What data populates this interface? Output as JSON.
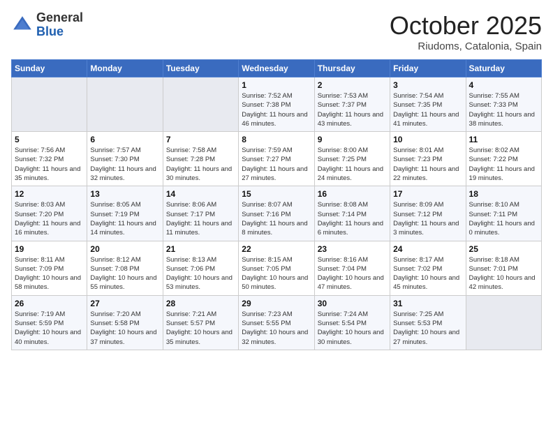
{
  "header": {
    "logo_general": "General",
    "logo_blue": "Blue",
    "month_title": "October 2025",
    "location": "Riudoms, Catalonia, Spain"
  },
  "weekdays": [
    "Sunday",
    "Monday",
    "Tuesday",
    "Wednesday",
    "Thursday",
    "Friday",
    "Saturday"
  ],
  "weeks": [
    [
      {
        "day": "",
        "empty": true
      },
      {
        "day": "",
        "empty": true
      },
      {
        "day": "",
        "empty": true
      },
      {
        "day": "1",
        "sunrise": "7:52 AM",
        "sunset": "7:38 PM",
        "daylight": "11 hours and 46 minutes."
      },
      {
        "day": "2",
        "sunrise": "7:53 AM",
        "sunset": "7:37 PM",
        "daylight": "11 hours and 43 minutes."
      },
      {
        "day": "3",
        "sunrise": "7:54 AM",
        "sunset": "7:35 PM",
        "daylight": "11 hours and 41 minutes."
      },
      {
        "day": "4",
        "sunrise": "7:55 AM",
        "sunset": "7:33 PM",
        "daylight": "11 hours and 38 minutes."
      }
    ],
    [
      {
        "day": "5",
        "sunrise": "7:56 AM",
        "sunset": "7:32 PM",
        "daylight": "11 hours and 35 minutes."
      },
      {
        "day": "6",
        "sunrise": "7:57 AM",
        "sunset": "7:30 PM",
        "daylight": "11 hours and 32 minutes."
      },
      {
        "day": "7",
        "sunrise": "7:58 AM",
        "sunset": "7:28 PM",
        "daylight": "11 hours and 30 minutes."
      },
      {
        "day": "8",
        "sunrise": "7:59 AM",
        "sunset": "7:27 PM",
        "daylight": "11 hours and 27 minutes."
      },
      {
        "day": "9",
        "sunrise": "8:00 AM",
        "sunset": "7:25 PM",
        "daylight": "11 hours and 24 minutes."
      },
      {
        "day": "10",
        "sunrise": "8:01 AM",
        "sunset": "7:23 PM",
        "daylight": "11 hours and 22 minutes."
      },
      {
        "day": "11",
        "sunrise": "8:02 AM",
        "sunset": "7:22 PM",
        "daylight": "11 hours and 19 minutes."
      }
    ],
    [
      {
        "day": "12",
        "sunrise": "8:03 AM",
        "sunset": "7:20 PM",
        "daylight": "11 hours and 16 minutes."
      },
      {
        "day": "13",
        "sunrise": "8:05 AM",
        "sunset": "7:19 PM",
        "daylight": "11 hours and 14 minutes."
      },
      {
        "day": "14",
        "sunrise": "8:06 AM",
        "sunset": "7:17 PM",
        "daylight": "11 hours and 11 minutes."
      },
      {
        "day": "15",
        "sunrise": "8:07 AM",
        "sunset": "7:16 PM",
        "daylight": "11 hours and 8 minutes."
      },
      {
        "day": "16",
        "sunrise": "8:08 AM",
        "sunset": "7:14 PM",
        "daylight": "11 hours and 6 minutes."
      },
      {
        "day": "17",
        "sunrise": "8:09 AM",
        "sunset": "7:12 PM",
        "daylight": "11 hours and 3 minutes."
      },
      {
        "day": "18",
        "sunrise": "8:10 AM",
        "sunset": "7:11 PM",
        "daylight": "11 hours and 0 minutes."
      }
    ],
    [
      {
        "day": "19",
        "sunrise": "8:11 AM",
        "sunset": "7:09 PM",
        "daylight": "10 hours and 58 minutes."
      },
      {
        "day": "20",
        "sunrise": "8:12 AM",
        "sunset": "7:08 PM",
        "daylight": "10 hours and 55 minutes."
      },
      {
        "day": "21",
        "sunrise": "8:13 AM",
        "sunset": "7:06 PM",
        "daylight": "10 hours and 53 minutes."
      },
      {
        "day": "22",
        "sunrise": "8:15 AM",
        "sunset": "7:05 PM",
        "daylight": "10 hours and 50 minutes."
      },
      {
        "day": "23",
        "sunrise": "8:16 AM",
        "sunset": "7:04 PM",
        "daylight": "10 hours and 47 minutes."
      },
      {
        "day": "24",
        "sunrise": "8:17 AM",
        "sunset": "7:02 PM",
        "daylight": "10 hours and 45 minutes."
      },
      {
        "day": "25",
        "sunrise": "8:18 AM",
        "sunset": "7:01 PM",
        "daylight": "10 hours and 42 minutes."
      }
    ],
    [
      {
        "day": "26",
        "sunrise": "7:19 AM",
        "sunset": "5:59 PM",
        "daylight": "10 hours and 40 minutes."
      },
      {
        "day": "27",
        "sunrise": "7:20 AM",
        "sunset": "5:58 PM",
        "daylight": "10 hours and 37 minutes."
      },
      {
        "day": "28",
        "sunrise": "7:21 AM",
        "sunset": "5:57 PM",
        "daylight": "10 hours and 35 minutes."
      },
      {
        "day": "29",
        "sunrise": "7:23 AM",
        "sunset": "5:55 PM",
        "daylight": "10 hours and 32 minutes."
      },
      {
        "day": "30",
        "sunrise": "7:24 AM",
        "sunset": "5:54 PM",
        "daylight": "10 hours and 30 minutes."
      },
      {
        "day": "31",
        "sunrise": "7:25 AM",
        "sunset": "5:53 PM",
        "daylight": "10 hours and 27 minutes."
      },
      {
        "day": "",
        "empty": true
      }
    ]
  ],
  "labels": {
    "sunrise": "Sunrise:",
    "sunset": "Sunset:",
    "daylight": "Daylight:"
  }
}
